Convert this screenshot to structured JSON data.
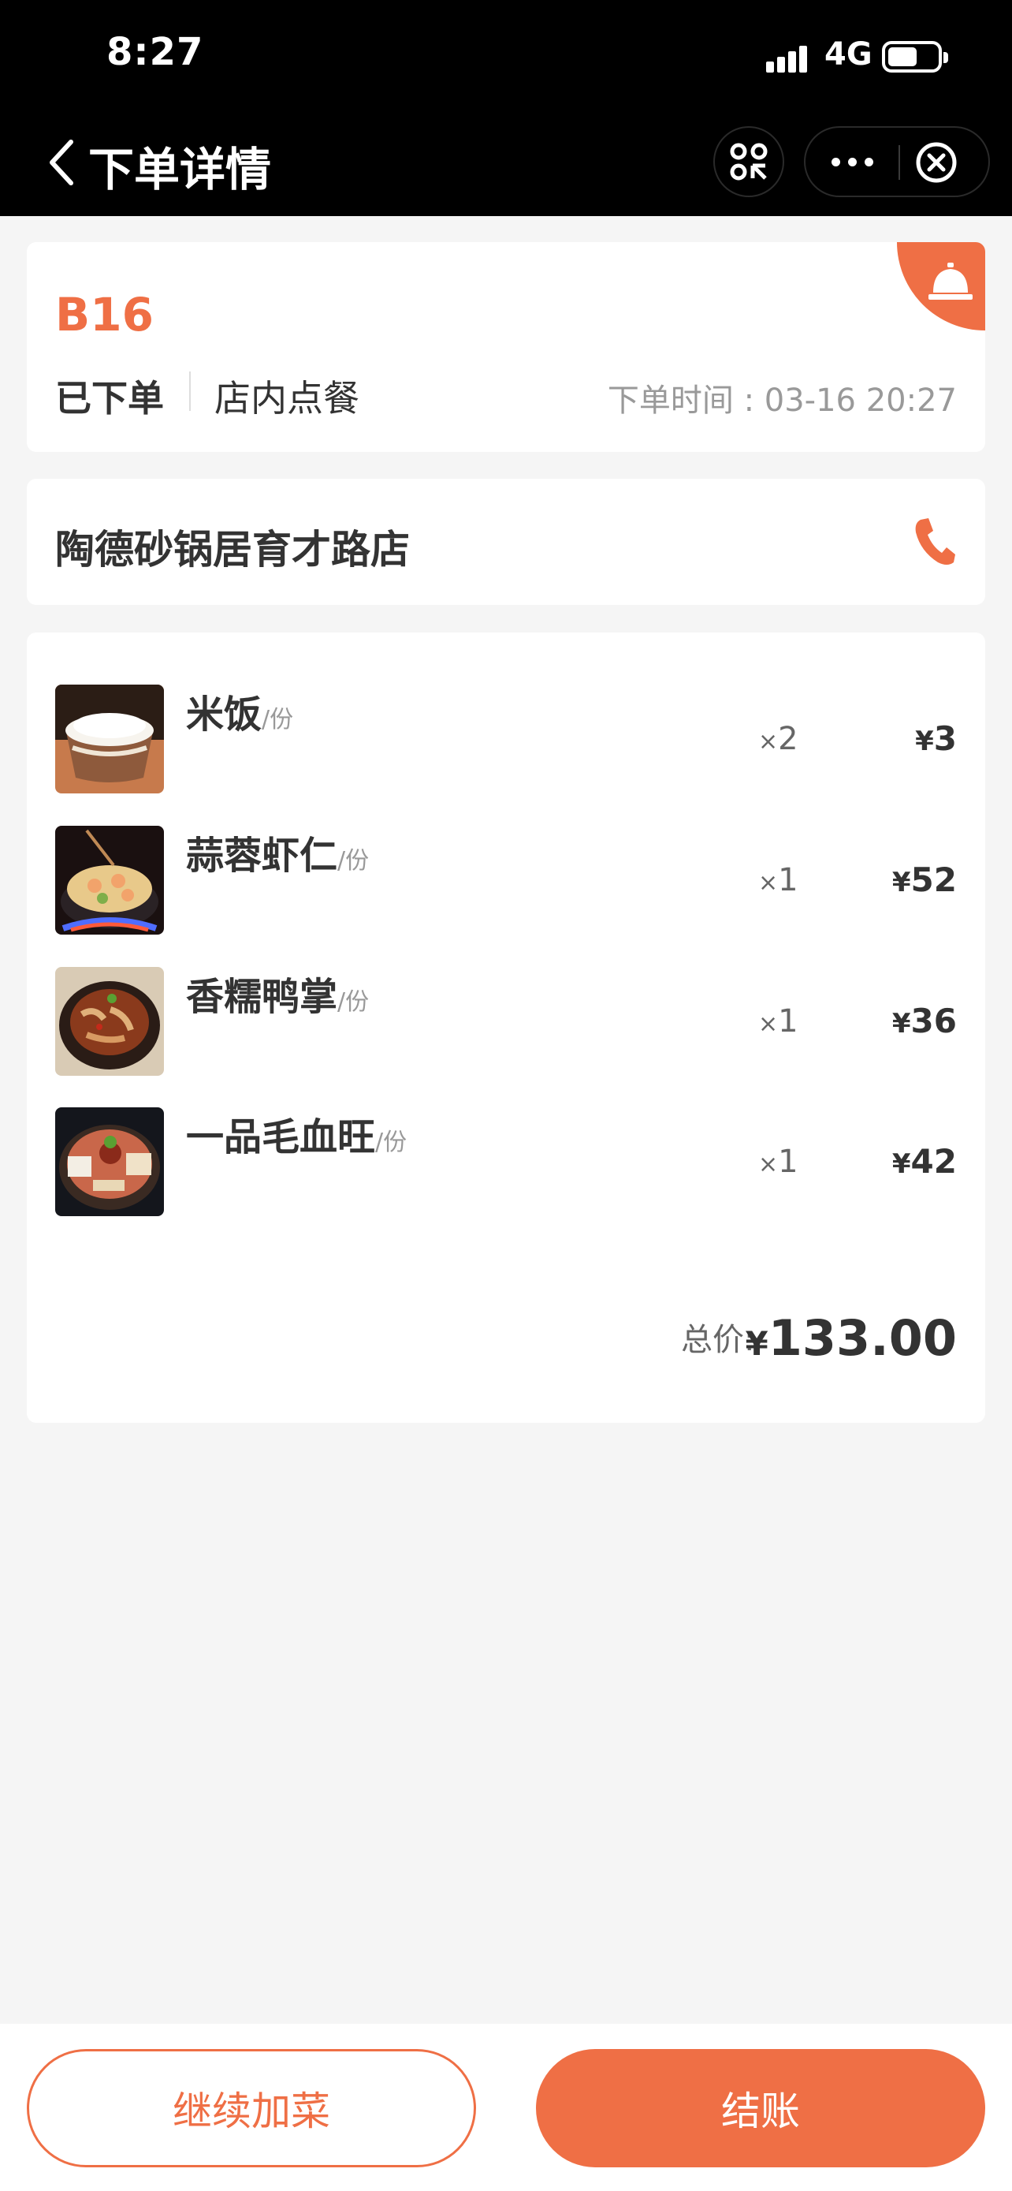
{
  "status_bar": {
    "time": "8:27",
    "network": "4G"
  },
  "nav": {
    "title": "下单详情"
  },
  "order": {
    "table_no": "B16",
    "status": "已下单",
    "dine_type": "店内点餐",
    "time_label": "下单时间 : 03-16 20:27"
  },
  "store": {
    "name": "陶德砂锅居育才路店"
  },
  "items": [
    {
      "name": "米饭",
      "unit": "/份",
      "qty_prefix": "×",
      "qty": "2",
      "currency": "¥",
      "price": "3"
    },
    {
      "name": "蒜蓉虾仁",
      "unit": "/份",
      "qty_prefix": "×",
      "qty": "1",
      "currency": "¥",
      "price": "52"
    },
    {
      "name": "香糯鸭掌",
      "unit": "/份",
      "qty_prefix": "×",
      "qty": "1",
      "currency": "¥",
      "price": "36"
    },
    {
      "name": "一品毛血旺",
      "unit": "/份",
      "qty_prefix": "×",
      "qty": "1",
      "currency": "¥",
      "price": "42"
    }
  ],
  "total": {
    "label": "总价:",
    "currency": "¥",
    "value": "133.00"
  },
  "actions": {
    "add_more": "继续加菜",
    "checkout": "结账"
  },
  "colors": {
    "accent": "#ef6f45",
    "header_bg": "#000000",
    "page_bg": "#f5f5f5"
  },
  "icons": [
    "back-icon",
    "scan-icon",
    "more-icon",
    "close-icon",
    "service-bell-icon",
    "phone-icon"
  ]
}
